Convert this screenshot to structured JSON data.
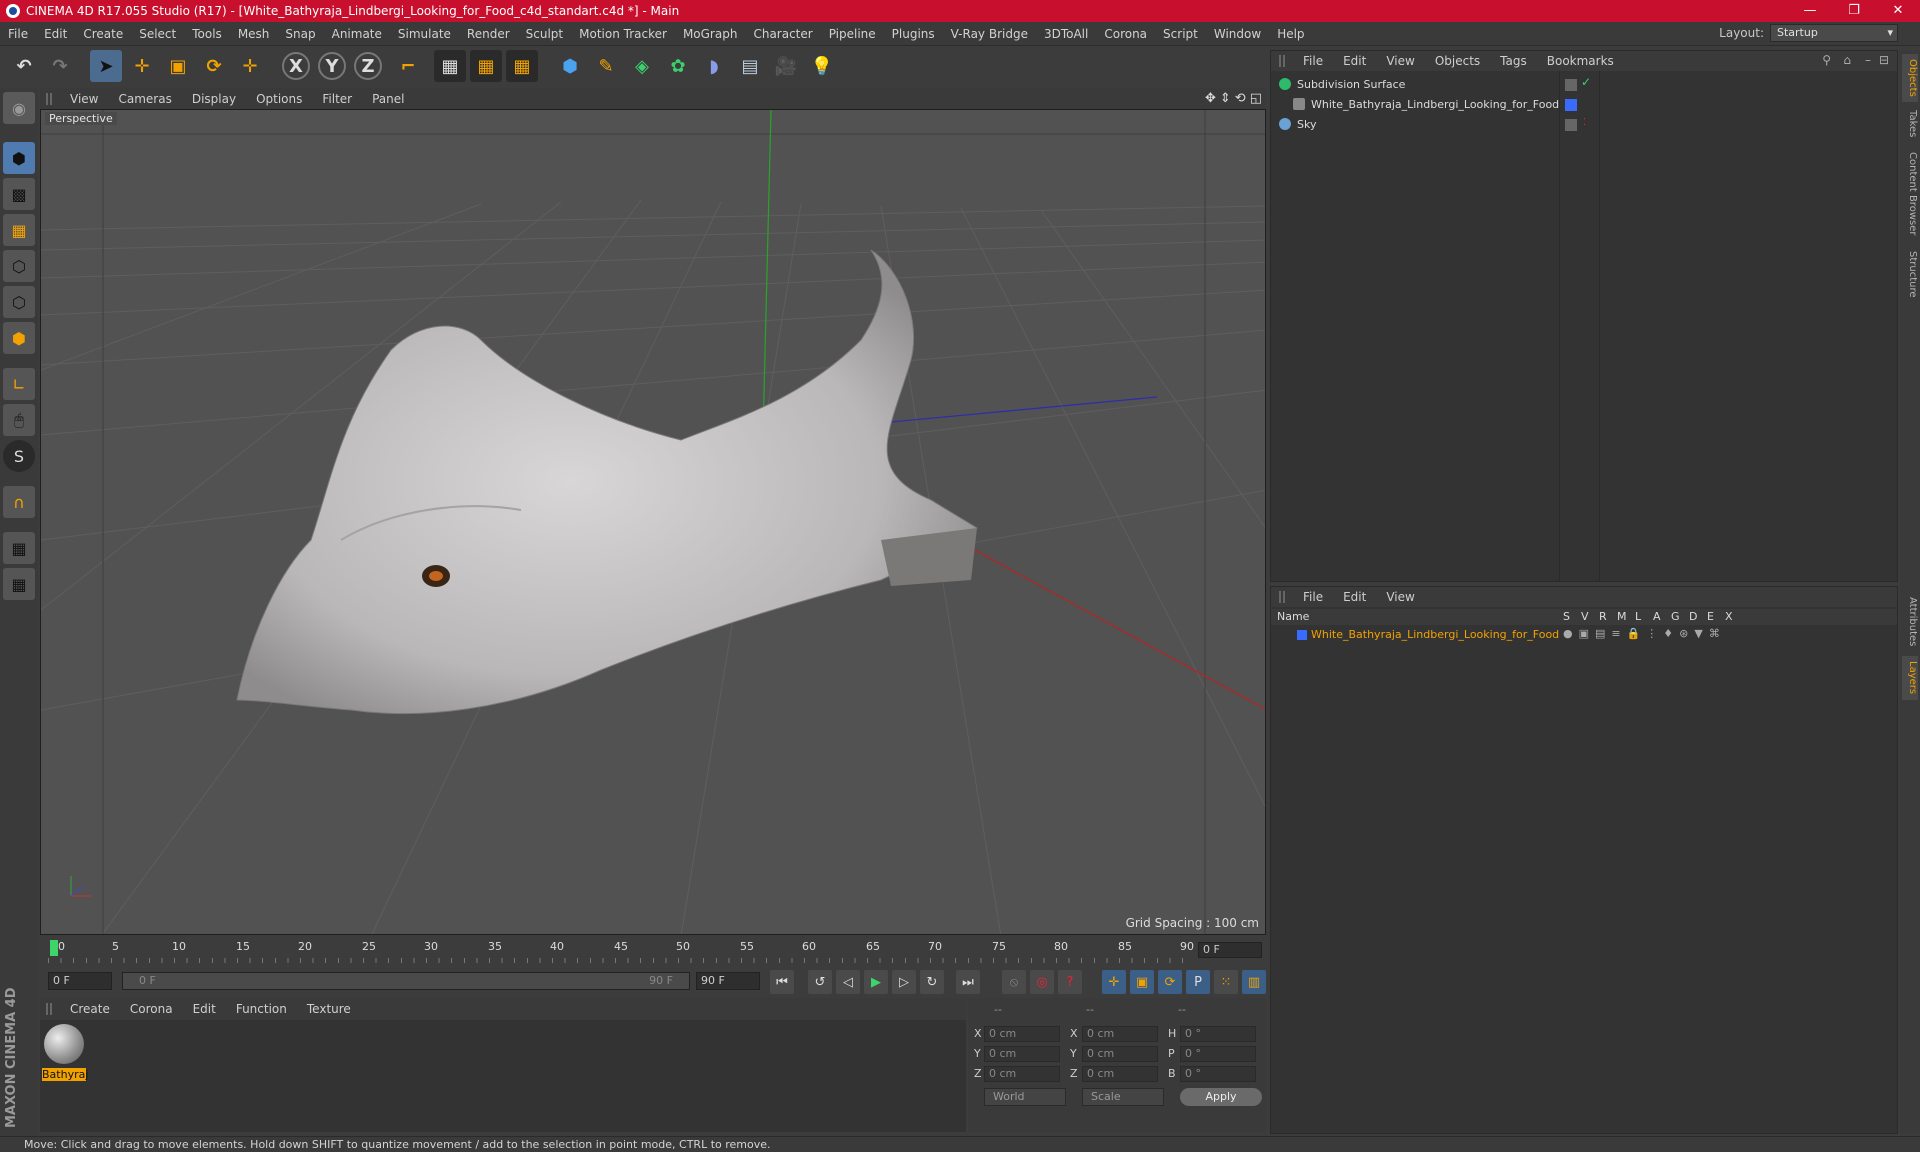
{
  "window": {
    "title": "CINEMA 4D R17.055 Studio (R17) - [White_Bathyraja_Lindbergi_Looking_for_Food_c4d_standart.c4d *] - Main",
    "controls": [
      "—",
      "❐",
      "✕"
    ]
  },
  "menubar": {
    "items": [
      "File",
      "Edit",
      "Create",
      "Select",
      "Tools",
      "Mesh",
      "Snap",
      "Animate",
      "Simulate",
      "Render",
      "Sculpt",
      "Motion Tracker",
      "MoGraph",
      "Character",
      "Pipeline",
      "Plugins",
      "V-Ray Bridge",
      "3DToAll",
      "Corona",
      "Script",
      "Window",
      "Help"
    ],
    "layout_label": "Layout:",
    "layout_value": "Startup"
  },
  "viewport": {
    "menu": [
      "View",
      "Cameras",
      "Display",
      "Options",
      "Filter",
      "Panel"
    ],
    "label": "Perspective",
    "grid_spacing": "Grid Spacing : 100 cm"
  },
  "timeline": {
    "ticks": [
      "0",
      "5",
      "10",
      "15",
      "20",
      "25",
      "30",
      "35",
      "40",
      "45",
      "50",
      "55",
      "60",
      "65",
      "70",
      "75",
      "80",
      "85",
      "90"
    ],
    "current_frame": "0 F",
    "start": "0 F",
    "slider_start": "0 F",
    "slider_end": "90 F",
    "end": "90 F"
  },
  "materials": {
    "menu": [
      "Create",
      "Corona",
      "Edit",
      "Function",
      "Texture"
    ],
    "items": [
      {
        "name": "Bathyraj"
      }
    ]
  },
  "coords": {
    "headers": [
      "--",
      "--",
      "--"
    ],
    "rows": [
      {
        "a": "X",
        "av": "0 cm",
        "b": "X",
        "bv": "0 cm",
        "c": "H",
        "cv": "0 °"
      },
      {
        "a": "Y",
        "av": "0 cm",
        "b": "Y",
        "bv": "0 cm",
        "c": "P",
        "cv": "0 °"
      },
      {
        "a": "Z",
        "av": "0 cm",
        "b": "Z",
        "bv": "0 cm",
        "c": "B",
        "cv": "0 °"
      }
    ],
    "mode": "World",
    "scale": "Scale",
    "apply": "Apply"
  },
  "objects_panel": {
    "menu": [
      "File",
      "Edit",
      "View",
      "Objects",
      "Tags",
      "Bookmarks"
    ],
    "objects": [
      {
        "name": "Subdivision Surface",
        "color": "#2dbb6a"
      },
      {
        "name": "White_Bathyraja_Lindbergi_Looking_for_Food",
        "color": "#3a6bff"
      },
      {
        "name": "Sky",
        "color": "#6ba2d6"
      }
    ]
  },
  "layers_panel": {
    "menu": [
      "File",
      "Edit",
      "View"
    ],
    "columns": [
      "Name",
      "S",
      "V",
      "R",
      "M",
      "L",
      "A",
      "G",
      "D",
      "E",
      "X"
    ],
    "layers": [
      {
        "name": "White_Bathyraja_Lindbergi_Looking_for_Food",
        "color": "#3a6bff"
      }
    ]
  },
  "right_tabs": [
    "Objects",
    "Takes",
    "Content Browser",
    "Structure",
    "Attributes",
    "Layers"
  ],
  "status": "Move: Click and drag to move elements. Hold down SHIFT to quantize movement / add to the selection in point mode, CTRL to remove.",
  "brand": "MAXON CINEMA 4D",
  "colors": {
    "accent": "#f2a200",
    "titlebar": "#c8102e",
    "tool_highlight": "#4f7bb0"
  }
}
